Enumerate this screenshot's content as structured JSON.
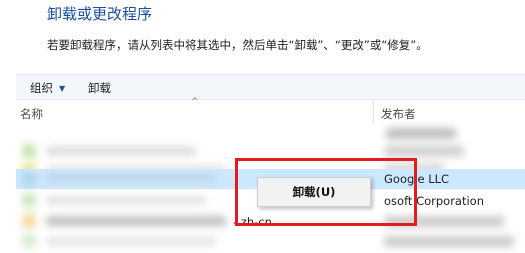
{
  "page": {
    "title": "卸载或更改程序",
    "instruction": "若要卸载程序，请从列表中将其选中，然后单击“卸载”、“更改”或“修复”。"
  },
  "toolbar": {
    "organize_label": "组织",
    "organize_arrow": "▼",
    "uninstall_label": "卸载"
  },
  "columns": {
    "name": "名称",
    "sort_indicator": "^",
    "publisher": "发布者"
  },
  "rows": [
    {
      "name": "",
      "publisher": ""
    },
    {
      "name": "",
      "publisher": ""
    },
    {
      "name": "",
      "publisher": ""
    },
    {
      "name": "",
      "publisher": "Google LLC",
      "selected": true
    },
    {
      "name": "",
      "publisher": "osoft Corporation"
    },
    {
      "name": "- zh-cn",
      "publisher": ""
    },
    {
      "name": "",
      "publisher": ""
    }
  ],
  "context_menu": {
    "items": [
      {
        "label": "卸载(U)"
      }
    ]
  },
  "colors": {
    "title": "#1a4f9c",
    "selection": "#cce8ff",
    "highlight_box": "#e11d1d",
    "toolbar_bg": "#f3f6fa"
  }
}
